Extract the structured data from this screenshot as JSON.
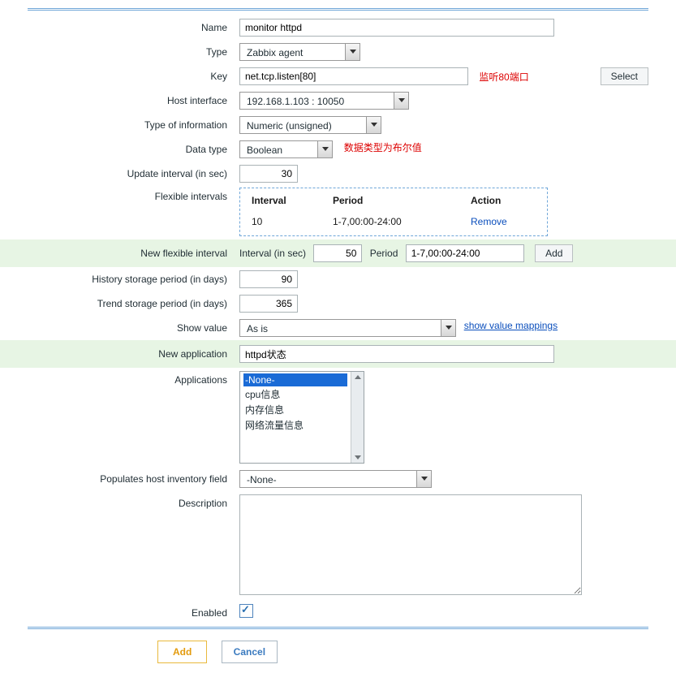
{
  "labels": {
    "name": "Name",
    "type": "Type",
    "key": "Key",
    "host_interface": "Host interface",
    "type_of_info": "Type of information",
    "data_type": "Data type",
    "update_interval": "Update interval (in sec)",
    "flexible_intervals": "Flexible intervals",
    "new_flexible_interval": "New flexible interval",
    "history": "History storage period (in days)",
    "trend": "Trend storage period (in days)",
    "show_value": "Show value",
    "new_application": "New application",
    "applications": "Applications",
    "populates_inv": "Populates host inventory field",
    "description": "Description",
    "enabled": "Enabled"
  },
  "values": {
    "name": "monitor httpd",
    "type": "Zabbix agent",
    "key": "net.tcp.listen[80]",
    "host_interface": "192.168.1.103 : 10050",
    "type_of_info": "Numeric (unsigned)",
    "data_type": "Boolean",
    "update_interval": "30",
    "new_interval_sec": "50",
    "new_interval_period": "1-7,00:00-24:00",
    "history": "90",
    "trend": "365",
    "show_value": "As is",
    "new_application": "httpd状态",
    "populates_inv": "-None-",
    "enabled": true
  },
  "annotations": {
    "key": "监听80端口",
    "data_type": "数据类型为布尔值"
  },
  "flex_table": {
    "headers": {
      "interval": "Interval",
      "period": "Period",
      "action": "Action"
    },
    "rows": [
      {
        "interval": "10",
        "period": "1-7,00:00-24:00",
        "action": "Remove"
      }
    ]
  },
  "new_flex": {
    "interval_label": "Interval (in sec)",
    "period_label": "Period"
  },
  "applications_list": [
    "-None-",
    "cpu信息",
    "内存信息",
    "网络流量信息"
  ],
  "buttons": {
    "select": "Select",
    "add": "Add",
    "submit": "Add",
    "cancel": "Cancel"
  },
  "links": {
    "show_value_mappings": "show value mappings"
  }
}
